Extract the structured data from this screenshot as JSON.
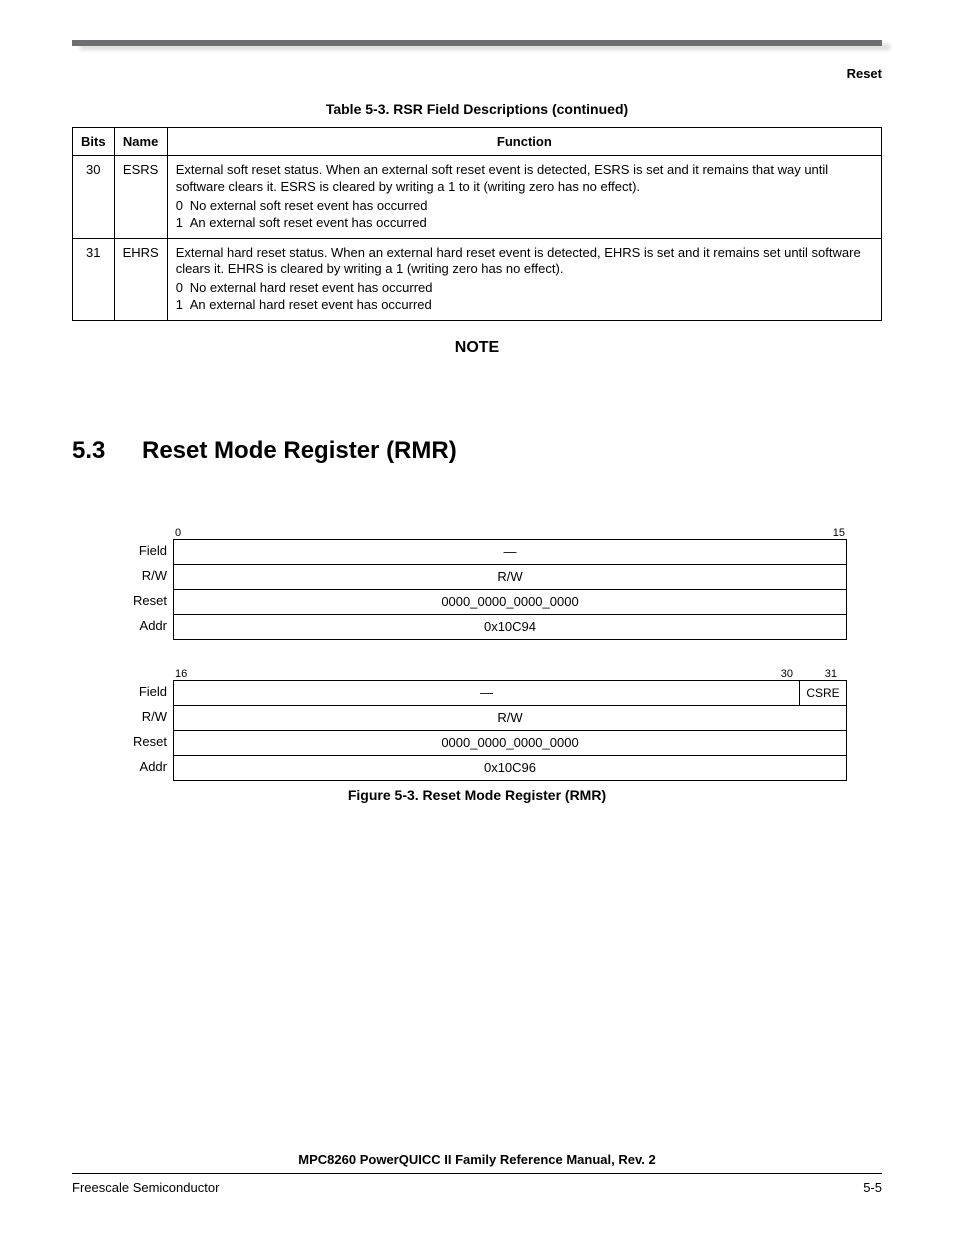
{
  "header": {
    "section": "Reset"
  },
  "table53": {
    "caption": "Table 5-3. RSR Field Descriptions (continued)",
    "headers": {
      "bits": "Bits",
      "name": "Name",
      "function": "Function"
    },
    "rows": [
      {
        "bits": "30",
        "name": "ESRS",
        "desc": "External soft reset status. When an external soft reset event is detected, ESRS is set and it remains that way until software clears it. ESRS is cleared by writing a 1 to it (writing zero has no effect).",
        "v0": "No external soft reset event has occurred",
        "v1": "An external soft reset event has occurred"
      },
      {
        "bits": "31",
        "name": "EHRS",
        "desc": "External hard reset status. When an external hard reset event is detected, EHRS is set and it remains set until software clears it. EHRS is cleared by writing a 1 (writing zero has no effect).",
        "v0": "No external hard reset event has occurred",
        "v1": "An external hard reset event has occurred"
      }
    ]
  },
  "note_label": "NOTE",
  "section_5_3": {
    "number": "5.3",
    "title": "Reset Mode Register (RMR)"
  },
  "figure53": {
    "caption": "Figure 5-3. Reset Mode Register (RMR)",
    "labels": {
      "field": "Field",
      "rw": "R/W",
      "reset": "Reset",
      "addr": "Addr"
    },
    "top": {
      "bit_left": "0",
      "bit_right": "15",
      "field": "—",
      "rw": "R/W",
      "reset": "0000_0000_0000_0000",
      "addr": "0x10C94"
    },
    "bottom": {
      "bit_left": "16",
      "bit_mid": "30",
      "bit_right": "31",
      "field_main": "—",
      "field_last": "CSRE",
      "rw": "R/W",
      "reset": "0000_0000_0000_0000",
      "addr": "0x10C96"
    }
  },
  "footer": {
    "manual": "MPC8260 PowerQUICC II Family Reference Manual, Rev. 2",
    "company": "Freescale Semiconductor",
    "page": "5-5"
  }
}
